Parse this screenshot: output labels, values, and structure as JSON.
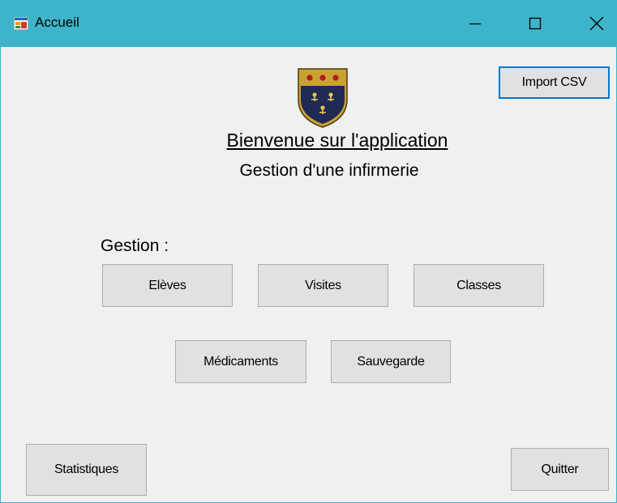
{
  "window": {
    "title": "Accueil",
    "accent_color": "#3db4c9",
    "controls": [
      "minimize-icon",
      "maximize-icon",
      "close-icon"
    ]
  },
  "header": {
    "logo": "coat-of-arms-crest",
    "welcome": "Bienvenue sur l'application",
    "subtitle": "Gestion d'une infirmerie"
  },
  "import_csv_label": "Import CSV",
  "gestion": {
    "label": "Gestion :",
    "buttons": [
      "Elèves",
      "Visites",
      "Classes",
      "Médicaments",
      "Sauvegarde"
    ]
  },
  "footer": {
    "statistiques_label": "Statistiques",
    "quitter_label": "Quitter"
  }
}
